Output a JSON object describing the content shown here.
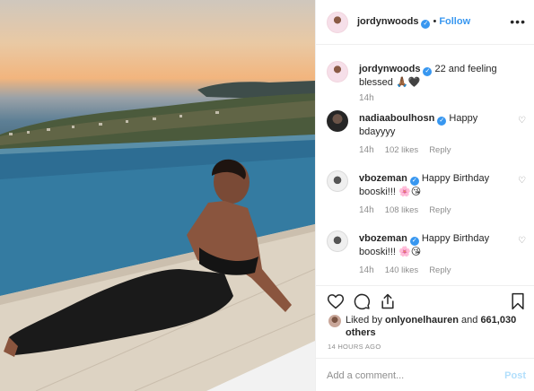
{
  "header": {
    "username": "jordynwoods",
    "separator": "•",
    "follow_label": "Follow",
    "more_icon": "more-horizontal-icon"
  },
  "caption": {
    "username": "jordynwoods",
    "text": "22 and feeling blessed 🙏🏾🖤",
    "time": "14h"
  },
  "comments": [
    {
      "username": "nadiaaboulhosn",
      "text": "Happy bdayyyy",
      "time": "14h",
      "likes": "102 likes",
      "reply": "Reply"
    },
    {
      "username": "vbozeman",
      "text": "Happy Birthday booski!!! 🌸😘",
      "time": "14h",
      "likes": "108 likes",
      "reply": "Reply"
    },
    {
      "username": "vbozeman",
      "text": "Happy Birthday booski!!! 🌸😘",
      "time": "14h",
      "likes": "140 likes",
      "reply": "Reply"
    }
  ],
  "likes": {
    "prefix": "Liked by",
    "user": "onlyonelhauren",
    "conj": "and",
    "count": "661,030 others"
  },
  "posted_time": "14 HOURS AGO",
  "comment_box": {
    "placeholder": "Add a comment...",
    "post_label": "Post"
  },
  "colors": {
    "accent": "#3897f0",
    "text": "#262626",
    "muted": "#8e8e8e",
    "border": "#efefef"
  }
}
